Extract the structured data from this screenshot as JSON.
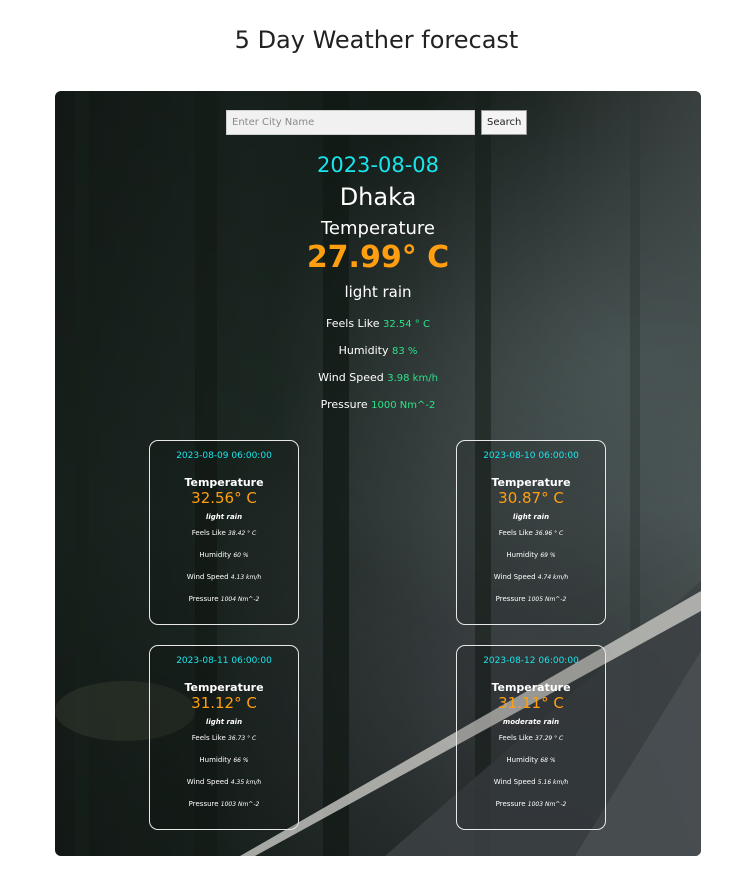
{
  "page": {
    "title": "5 Day Weather forecast"
  },
  "search": {
    "placeholder": "Enter City Name",
    "value": "",
    "button_label": "Search"
  },
  "current": {
    "date": "2023-08-08",
    "city": "Dhaka",
    "temperature_label": "Temperature",
    "temperature": "27.99° C",
    "description": "light rain",
    "stats": [
      {
        "label": "Feels Like",
        "value": "32.54 ° C"
      },
      {
        "label": "Humidity",
        "value": "83 %"
      },
      {
        "label": "Wind Speed",
        "value": "3.98 km/h"
      },
      {
        "label": "Pressure",
        "value": "1000 Nm^-2"
      }
    ]
  },
  "forecast": [
    {
      "date": "2023-08-09 06:00:00",
      "temperature_label": "Temperature",
      "temperature": "32.56° C",
      "description": "light rain",
      "stats": [
        {
          "label": "Feels Like",
          "value": "38.42 ° C"
        },
        {
          "label": "Humidity",
          "value": "60 %"
        },
        {
          "label": "Wind Speed",
          "value": "4.13 km/h"
        },
        {
          "label": "Pressure",
          "value": "1004 Nm^-2"
        }
      ]
    },
    {
      "date": "2023-08-10 06:00:00",
      "temperature_label": "Temperature",
      "temperature": "30.87° C",
      "description": "light rain",
      "stats": [
        {
          "label": "Feels Like",
          "value": "36.96 ° C"
        },
        {
          "label": "Humidity",
          "value": "69 %"
        },
        {
          "label": "Wind Speed",
          "value": "4.74 km/h"
        },
        {
          "label": "Pressure",
          "value": "1005 Nm^-2"
        }
      ]
    },
    {
      "date": "2023-08-11 06:00:00",
      "temperature_label": "Temperature",
      "temperature": "31.12° C",
      "description": "light rain",
      "stats": [
        {
          "label": "Feels Like",
          "value": "36.73 ° C"
        },
        {
          "label": "Humidity",
          "value": "66 %"
        },
        {
          "label": "Wind Speed",
          "value": "4.35 km/h"
        },
        {
          "label": "Pressure",
          "value": "1003 Nm^-2"
        }
      ]
    },
    {
      "date": "2023-08-12 06:00:00",
      "temperature_label": "Temperature",
      "temperature": "31.11° C",
      "description": "moderate rain",
      "stats": [
        {
          "label": "Feels Like",
          "value": "37.29 ° C"
        },
        {
          "label": "Humidity",
          "value": "68 %"
        },
        {
          "label": "Wind Speed",
          "value": "5.16 km/h"
        },
        {
          "label": "Pressure",
          "value": "1003 Nm^-2"
        }
      ]
    }
  ],
  "colors": {
    "date": "#19e6ec",
    "temperature": "#ff9f10",
    "stat_value": "#2ce08a"
  }
}
